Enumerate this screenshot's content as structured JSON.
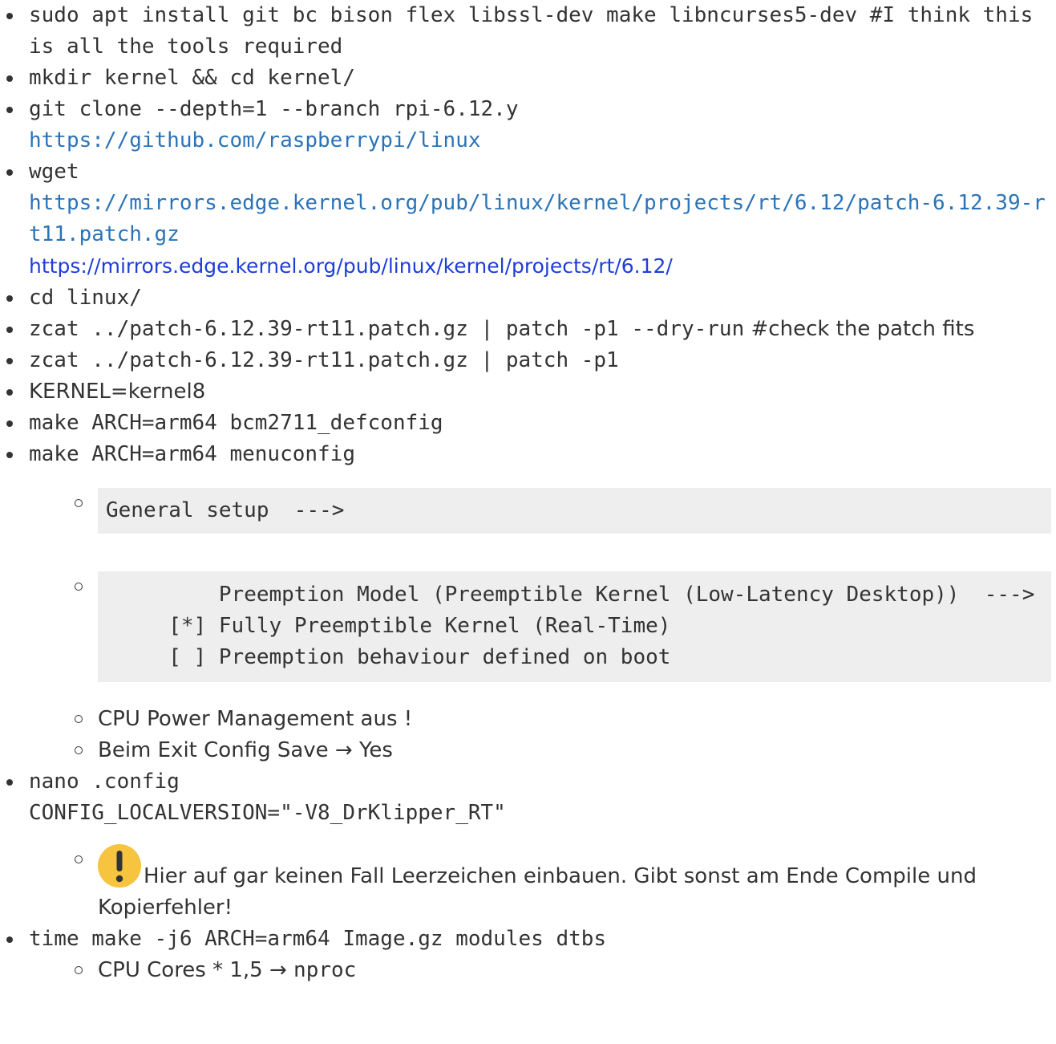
{
  "colors": {
    "text": "#333333",
    "link_external": "#2b73b7",
    "link_wiki": "#1e3ed8",
    "code_background": "#eeeeee",
    "warning_icon_bg": "#f6c43f"
  },
  "items": {
    "apt_install": {
      "command": "sudo apt install git bc bison flex libssl-dev make libncurses5-dev #I think this is all the tools required"
    },
    "mkdir": {
      "command": "mkdir kernel && cd kernel/"
    },
    "git_clone": {
      "command": "git clone --depth=1 --branch rpi-6.12.y",
      "link": "https://github.com/raspberrypi/linux"
    },
    "wget": {
      "command": "wget",
      "link_patch": "https://mirrors.edge.kernel.org/pub/linux/kernel/projects/rt/6.12/patch-6.12.39-rt11.patch.gz",
      "link_dir": "https://mirrors.edge.kernel.org/pub/linux/kernel/projects/rt/6.12/"
    },
    "cd_linux": {
      "command": "cd linux/"
    },
    "zcat_dry": {
      "command": "zcat ../patch-6.12.39-rt11.patch.gz | patch -p1 --dry-run",
      "comment": "#check the patch fits"
    },
    "zcat": {
      "command": "zcat ../patch-6.12.39-rt11.patch.gz | patch -p1"
    },
    "kernel_var": {
      "command": "KERNEL=kernel8"
    },
    "defconfig": {
      "command": "make ARCH=arm64 bcm2711_defconfig"
    },
    "menuconfig": {
      "command": "make ARCH=arm64 menuconfig",
      "sub": {
        "general_setup": "General setup  --->",
        "preemption": "         Preemption Model (Preemptible Kernel (Low-Latency Desktop))  --->\n     [*] Fully Preemptible Kernel (Real-Time)\n     [ ] Preemption behaviour defined on boot",
        "cpu_power": "CPU Power Management aus !",
        "exit_save": "Beim Exit Config Save → Yes"
      }
    },
    "nano": {
      "command": "nano .config",
      "config_line": "CONFIG_LOCALVERSION=\"-V8_DrKlipper_RT\"",
      "warning": "Hier auf gar keinen Fall Leerzeichen einbauen. Gibt sonst am Ende Compile und Kopierfehler!",
      "warning_icon": "exclamation-icon"
    },
    "time_make": {
      "command": "time make -j6 ARCH=arm64 Image.gz modules dtbs",
      "sub_prefix": "CPU Cores * 1,5 →",
      "sub_code": "nproc"
    }
  }
}
